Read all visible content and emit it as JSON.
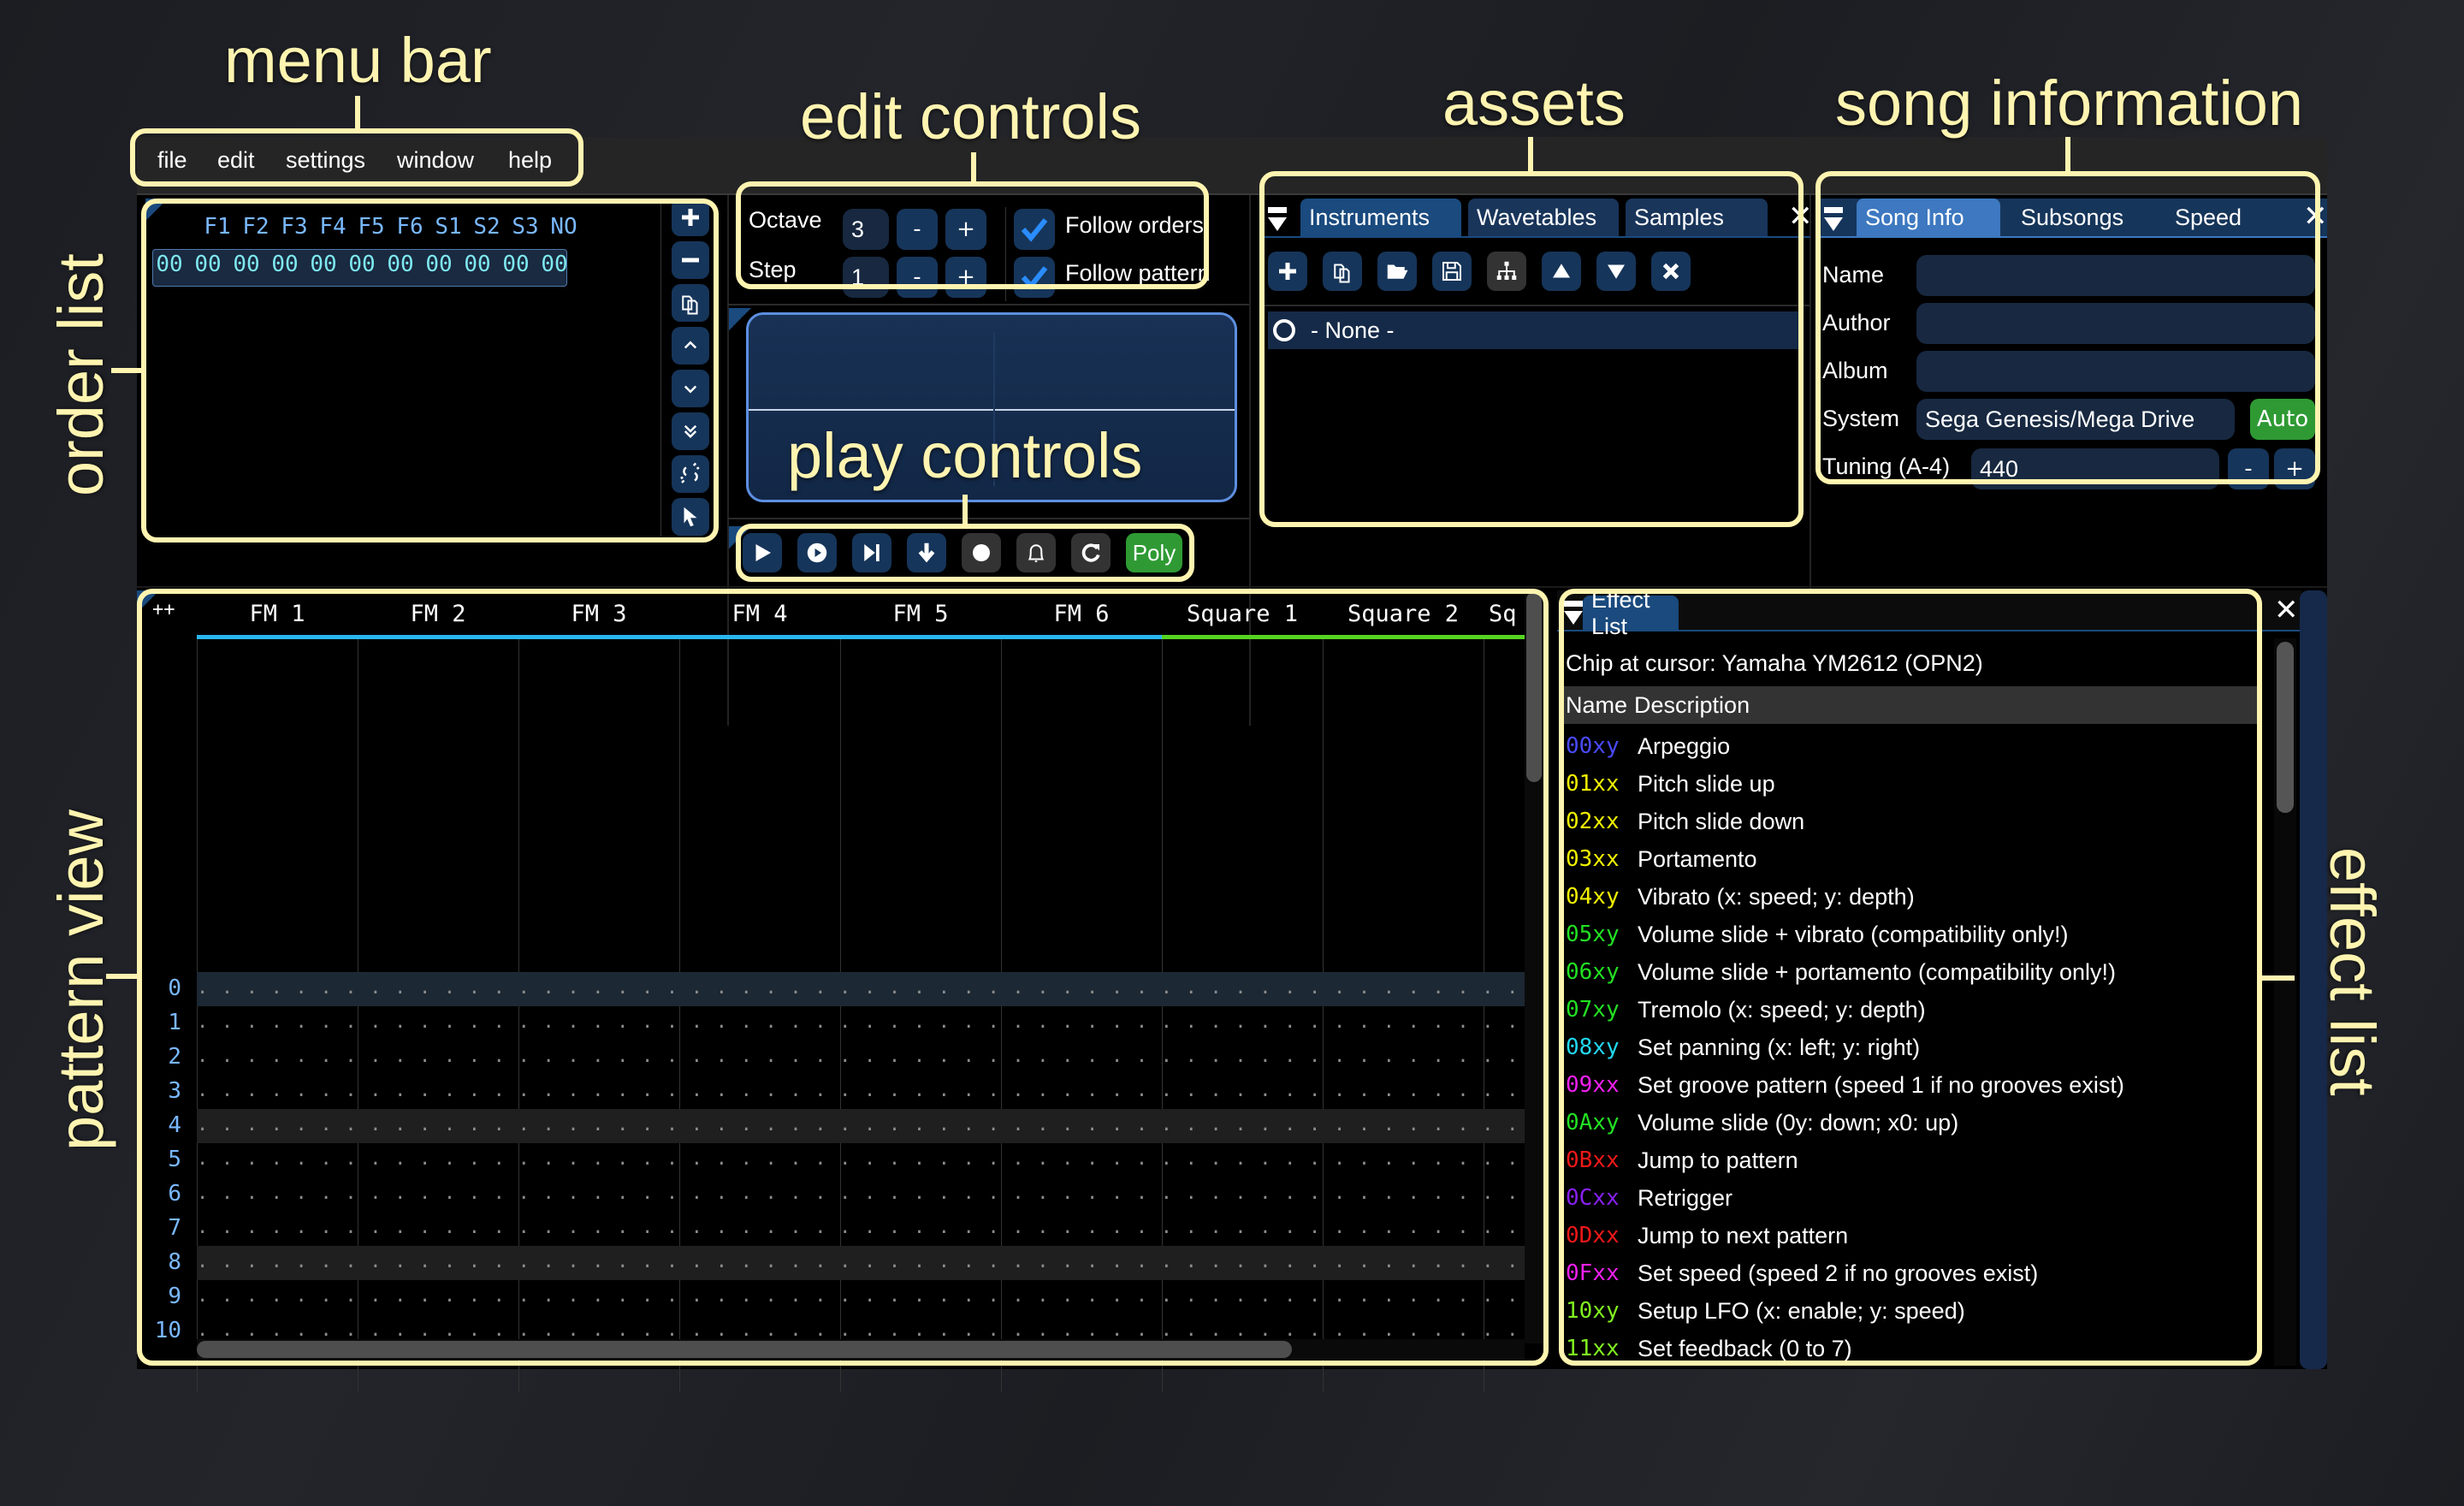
{
  "annotations": {
    "menu_bar": "menu bar",
    "edit_controls": "edit controls",
    "assets": "assets",
    "song_information": "song information",
    "order_list": "order list",
    "play_controls": "play controls",
    "pattern_view": "pattern view",
    "effect_list": "effect list"
  },
  "menu": [
    "file",
    "edit",
    "settings",
    "window",
    "help"
  ],
  "order_list": {
    "headers": [
      "F1",
      "F2",
      "F3",
      "F4",
      "F5",
      "F6",
      "S1",
      "S2",
      "S3",
      "NO"
    ],
    "rows": [
      [
        "00",
        "00",
        "00",
        "00",
        "00",
        "00",
        "00",
        "00",
        "00",
        "00",
        "00"
      ]
    ],
    "buttons": [
      "plus-icon",
      "minus-icon",
      "duplicate-icon",
      "chevron-up-icon",
      "chevron-down-icon",
      "double-chevron-down-icon",
      "unlink-icon",
      "pointer-icon"
    ]
  },
  "edit_controls": {
    "octave_label": "Octave",
    "octave_value": "3",
    "step_label": "Step",
    "step_value": "1",
    "minus": "-",
    "plus": "+",
    "follow_orders_label": "Follow orders",
    "follow_orders_checked": true,
    "follow_pattern_label": "Follow pattern",
    "follow_pattern_checked": true
  },
  "play_controls": {
    "buttons": [
      "play-icon",
      "play-pattern-icon",
      "step-one-row-icon",
      "edit-mode-icon",
      "record-icon",
      "metronome-icon",
      "repeat-pattern-icon"
    ],
    "poly_label": "Poly"
  },
  "assets": {
    "tabs": [
      "Instruments",
      "Wavetables",
      "Samples"
    ],
    "active_tab": "Instruments",
    "toolbar": [
      "add-icon",
      "duplicate-icon",
      "open-folder-icon",
      "save-icon",
      "tree-view-icon",
      "move-up-icon",
      "move-down-icon",
      "delete-icon"
    ],
    "items": [
      "- None -"
    ]
  },
  "song_info": {
    "tabs": [
      "Song Info",
      "Subsongs",
      "Speed"
    ],
    "active_tab": "Song Info",
    "name_label": "Name",
    "name_value": "",
    "author_label": "Author",
    "author_value": "",
    "album_label": "Album",
    "album_value": "",
    "system_label": "System",
    "system_value": "Sega Genesis/Mega Drive",
    "auto_label": "Auto",
    "tuning_label": "Tuning (A-4)",
    "tuning_value": "440",
    "minus": "-",
    "plus": "+"
  },
  "pattern_view": {
    "corner_label": "++",
    "channels": [
      {
        "name": "FM 1",
        "color": "#29b6f0"
      },
      {
        "name": "FM 2",
        "color": "#29b6f0"
      },
      {
        "name": "FM 3",
        "color": "#29b6f0"
      },
      {
        "name": "FM 4",
        "color": "#29b6f0"
      },
      {
        "name": "FM 5",
        "color": "#29b6f0"
      },
      {
        "name": "FM 6",
        "color": "#29b6f0"
      },
      {
        "name": "Square 1",
        "color": "#55d422"
      },
      {
        "name": "Square 2",
        "color": "#55d422"
      },
      {
        "name": "Sq",
        "color": "#55d422"
      }
    ],
    "row_numbers": [
      "0",
      "1",
      "2",
      "3",
      "4",
      "5",
      "6",
      "7",
      "8",
      "9",
      "10"
    ]
  },
  "effect_list": {
    "tab": "Effect List",
    "chip_line": "Chip at cursor: Yamaha YM2612 (OPN2)",
    "col_name": "Name",
    "col_desc": "Description",
    "effects": [
      {
        "code": "00xy",
        "desc": "Arpeggio",
        "color": "#4a4aff"
      },
      {
        "code": "01xx",
        "desc": "Pitch slide up",
        "color": "#f0f000"
      },
      {
        "code": "02xx",
        "desc": "Pitch slide down",
        "color": "#f0f000"
      },
      {
        "code": "03xx",
        "desc": "Portamento",
        "color": "#f0f000"
      },
      {
        "code": "04xy",
        "desc": "Vibrato (x: speed; y: depth)",
        "color": "#f0f000"
      },
      {
        "code": "05xy",
        "desc": "Volume slide + vibrato (compatibility only!)",
        "color": "#22e022"
      },
      {
        "code": "06xy",
        "desc": "Volume slide + portamento (compatibility only!)",
        "color": "#22e022"
      },
      {
        "code": "07xy",
        "desc": "Tremolo (x: speed; y: depth)",
        "color": "#22e022"
      },
      {
        "code": "08xy",
        "desc": "Set panning (x: left; y: right)",
        "color": "#22d8f0"
      },
      {
        "code": "09xx",
        "desc": "Set groove pattern (speed 1 if no grooves exist)",
        "color": "#f020f0"
      },
      {
        "code": "0Axy",
        "desc": "Volume slide (0y: down; x0: up)",
        "color": "#22e022"
      },
      {
        "code": "0Bxx",
        "desc": "Jump to pattern",
        "color": "#f01818"
      },
      {
        "code": "0Cxx",
        "desc": "Retrigger",
        "color": "#8820f0"
      },
      {
        "code": "0Dxx",
        "desc": "Jump to next pattern",
        "color": "#f01818"
      },
      {
        "code": "0Fxx",
        "desc": "Set speed (speed 2 if no grooves exist)",
        "color": "#f020f0"
      },
      {
        "code": "10xy",
        "desc": "Setup LFO (x: enable; y: speed)",
        "color": "#80f020"
      },
      {
        "code": "11xx",
        "desc": "Set feedback (0 to 7)",
        "color": "#80f020"
      }
    ]
  },
  "colors": {
    "annotation": "#fff4b0",
    "button_bg": "#16355a",
    "poly_green": "#2f9a34",
    "accent_blue": "#3d78c0"
  }
}
